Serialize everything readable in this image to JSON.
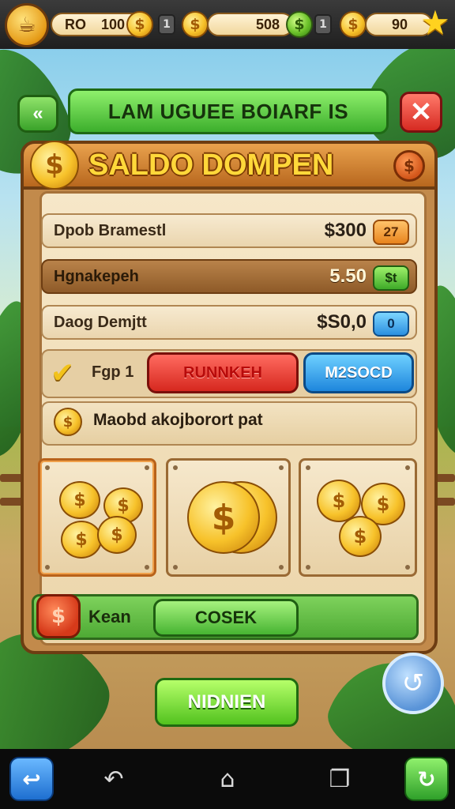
{
  "topbar": {
    "resource1": {
      "label": "RO",
      "value": "100"
    },
    "resource2": {
      "value": "508"
    },
    "resource3": {
      "value": "90"
    },
    "mini1": "1",
    "mini2": "1"
  },
  "header": {
    "title": "LAM UGUEE BOIARF IS"
  },
  "panel": {
    "title": "SALDO DOMPEN",
    "rows": [
      {
        "label": "Dpob Bramestl",
        "amount": "$300",
        "tag": "27"
      },
      {
        "label": "Hgnakepeh",
        "amount": "5.50",
        "tag": "$t"
      },
      {
        "label": "Daog Demjtt",
        "amount": "$S0,0",
        "tag": "0"
      }
    ],
    "action": {
      "label": "Fgp 1",
      "red_button": "RUNNKEH",
      "blue_button": "M2SOCD"
    },
    "info_text": "Maobd akojborort pat",
    "bottom": {
      "label": "Kean",
      "check_button": "COSEK"
    }
  },
  "main_button": "NIDNIEN",
  "colors": {
    "accent_green": "#4eaa34",
    "accent_red": "#d6281f",
    "accent_blue": "#1e86dc",
    "gold": "#f7c22a",
    "wood": "#c28a4b"
  },
  "icons": [
    "trophy-cup-icon",
    "coin-icon",
    "star-icon",
    "back-arrows-icon",
    "close-icon",
    "check-icon",
    "coin-pile-icon",
    "big-coin-icon",
    "refresh-icon",
    "nav-back-icon",
    "nav-home-icon",
    "nav-recents-icon"
  ]
}
